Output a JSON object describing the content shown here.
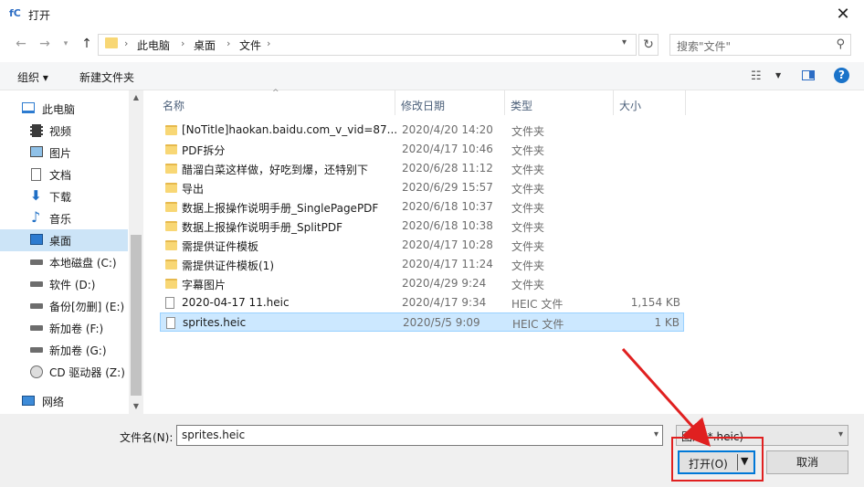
{
  "window": {
    "title": "打开",
    "app_icon_text": "fC"
  },
  "address": {
    "crumbs": [
      "此电脑",
      "桌面",
      "文件"
    ],
    "search_placeholder": "搜索\"文件\""
  },
  "toolbar": {
    "organize": "组织 ▾",
    "new_folder": "新建文件夹"
  },
  "nav": {
    "items": [
      {
        "label": "此电脑",
        "icon": "computer-icon"
      },
      {
        "label": "视频",
        "icon": "video-icon"
      },
      {
        "label": "图片",
        "icon": "picture-icon"
      },
      {
        "label": "文档",
        "icon": "document-icon"
      },
      {
        "label": "下载",
        "icon": "download-icon"
      },
      {
        "label": "音乐",
        "icon": "music-icon"
      },
      {
        "label": "桌面",
        "icon": "desktop-icon"
      },
      {
        "label": "本地磁盘 (C:)",
        "icon": "drive-icon"
      },
      {
        "label": "软件 (D:)",
        "icon": "drive-icon"
      },
      {
        "label": "备份[勿删] (E:)",
        "icon": "drive-icon"
      },
      {
        "label": "新加卷 (F:)",
        "icon": "drive-icon"
      },
      {
        "label": "新加卷 (G:)",
        "icon": "drive-icon"
      },
      {
        "label": "CD 驱动器 (Z:)",
        "icon": "cd-drive-icon"
      },
      {
        "label": "网络",
        "icon": "network-icon"
      }
    ]
  },
  "columns": {
    "name": "名称",
    "date": "修改日期",
    "type": "类型",
    "size": "大小"
  },
  "files": [
    {
      "name": "[NoTitle]haokan.baidu.com_v_vid=87...",
      "date": "2020/4/20 14:20",
      "type": "文件夹",
      "size": "",
      "kind": "folder"
    },
    {
      "name": "PDF拆分",
      "date": "2020/4/17 10:46",
      "type": "文件夹",
      "size": "",
      "kind": "folder"
    },
    {
      "name": "醋溜白菜这样做，好吃到爆，还特别下",
      "date": "2020/6/28 11:12",
      "type": "文件夹",
      "size": "",
      "kind": "folder"
    },
    {
      "name": "导出",
      "date": "2020/6/29 15:57",
      "type": "文件夹",
      "size": "",
      "kind": "folder"
    },
    {
      "name": "数据上报操作说明手册_SinglePagePDF",
      "date": "2020/6/18 10:37",
      "type": "文件夹",
      "size": "",
      "kind": "folder"
    },
    {
      "name": "数据上报操作说明手册_SplitPDF",
      "date": "2020/6/18 10:38",
      "type": "文件夹",
      "size": "",
      "kind": "folder"
    },
    {
      "name": "需提供证件模板",
      "date": "2020/4/17 10:28",
      "type": "文件夹",
      "size": "",
      "kind": "folder"
    },
    {
      "name": "需提供证件模板(1)",
      "date": "2020/4/17 11:24",
      "type": "文件夹",
      "size": "",
      "kind": "folder"
    },
    {
      "name": "字幕图片",
      "date": "2020/4/29 9:24",
      "type": "文件夹",
      "size": "",
      "kind": "folder"
    },
    {
      "name": "2020-04-17 11.heic",
      "date": "2020/4/17 9:34",
      "type": "HEIC 文件",
      "size": "1,154 KB",
      "kind": "file"
    },
    {
      "name": "sprites.heic",
      "date": "2020/5/5 9:09",
      "type": "HEIC 文件",
      "size": "1 KB",
      "kind": "file",
      "selected": true
    }
  ],
  "bottom": {
    "filename_label": "文件名(N):",
    "filename_value": "sprites.heic",
    "filter_value": "图片(*.heic)",
    "open_label": "打开(O)",
    "cancel_label": "取消"
  },
  "colors": {
    "selection": "#cce8ff",
    "accent": "#0078d7",
    "annotation": "#e02020"
  }
}
